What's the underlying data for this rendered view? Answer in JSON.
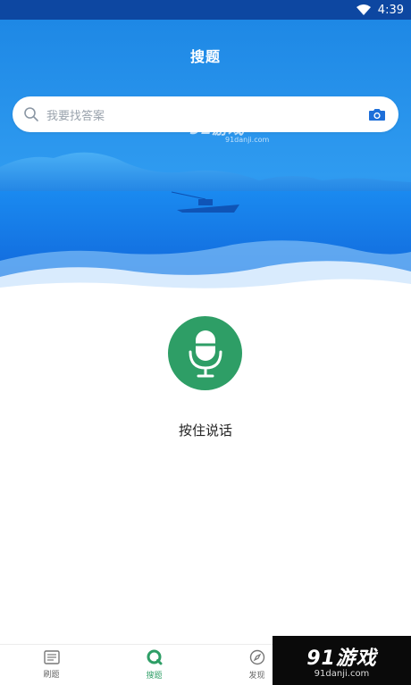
{
  "status_bar": {
    "time": "4:39"
  },
  "header": {
    "title": "搜题"
  },
  "search": {
    "placeholder": "我要找答案"
  },
  "watermark": {
    "main": "91游戏",
    "sub": "91danji.com"
  },
  "voice": {
    "hold_label": "按住说话"
  },
  "tabs": [
    {
      "label": "刷题",
      "icon": "list-icon",
      "active": false
    },
    {
      "label": "搜题",
      "icon": "search-tab-icon",
      "active": true
    },
    {
      "label": "发现",
      "icon": "compass-icon",
      "active": false
    }
  ],
  "brand_corner": {
    "main": "91游戏",
    "sub": "91danji.com"
  },
  "colors": {
    "status_bar": "#0d47a1",
    "hero_top": "#1e88e5",
    "accent_green": "#2e9e66",
    "camera_blue": "#1e6fd9"
  }
}
